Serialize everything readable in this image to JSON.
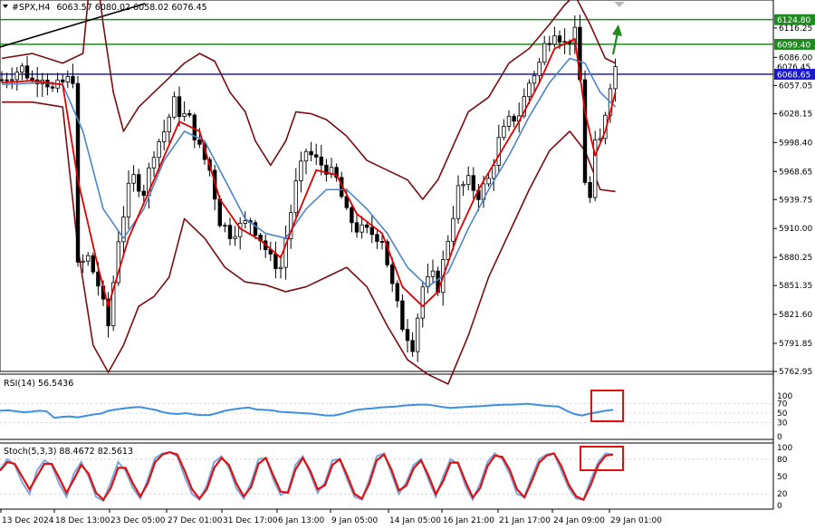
{
  "header": {
    "symbol": "#SPX,H4",
    "ohlc": "6063.57 6080.02 6058.02 6076.45"
  },
  "rsi_label": "RSI(14) 56.5436",
  "stoch_label": "Stoch(5,3,3) 88.4672 82.5613",
  "colors": {
    "candle": "#000000",
    "bb": "#7a0d10",
    "ma_fast": "#e00000",
    "ma_slow": "#4a86c8",
    "rsi": "#3d8fe0",
    "stoch_main": "#7ba7de",
    "stoch_signal": "#e01010",
    "resistance": "#1f8a1f",
    "current": "#1a1acc",
    "trend": "#000000",
    "highlight": "#e01010",
    "arrow": "#1f8a1f"
  },
  "chart_data": [
    {
      "type": "candlestick",
      "price_ticks": [
        6116.25,
        6086.0,
        6057.05,
        6028.15,
        5998.4,
        5968.65,
        5939.75,
        5910.0,
        5880.25,
        5851.35,
        5821.6,
        5791.85,
        5762.95
      ],
      "ylim": [
        5762.95,
        6145.0
      ],
      "price_tags": [
        {
          "value": 6124.8,
          "label": "6124.80",
          "kind": "resistance"
        },
        {
          "value": 6099.4,
          "label": "6099.40",
          "kind": "resistance"
        },
        {
          "value": 6076.45,
          "label": "6076.45",
          "kind": "last"
        },
        {
          "value": 6068.65,
          "label": "6068.65",
          "kind": "current"
        }
      ],
      "time_labels": [
        "13 Dec 2024",
        "18 Dec 13:00",
        "23 Dec 05:00",
        "27 Dec 01:00",
        "31 Dec 17:00",
        "6 Jan 13:00",
        "9 Jan 05:00",
        "14 Jan 05:00",
        "16 Jan 21:00",
        "21 Jan 17:00",
        "24 Jan 09:00",
        "29 Jan 01:00"
      ],
      "close_path": [
        [
          0,
          6063
        ],
        [
          4,
          6075
        ],
        [
          6,
          6062
        ],
        [
          8,
          6068
        ],
        [
          10,
          6052
        ],
        [
          12,
          6060
        ],
        [
          14,
          6065
        ],
        [
          15,
          5870
        ],
        [
          17,
          5880
        ],
        [
          19,
          5852
        ],
        [
          21,
          5810
        ],
        [
          23,
          5900
        ],
        [
          25,
          5950
        ],
        [
          26,
          5962
        ],
        [
          28,
          5948
        ],
        [
          30,
          5990
        ],
        [
          32,
          6010
        ],
        [
          34,
          6040
        ],
        [
          35,
          6030
        ],
        [
          37,
          6022
        ],
        [
          39,
          5992
        ],
        [
          41,
          5970
        ],
        [
          43,
          5918
        ],
        [
          45,
          5905
        ],
        [
          47,
          5912
        ],
        [
          49,
          5918
        ],
        [
          51,
          5900
        ],
        [
          53,
          5878
        ],
        [
          55,
          5870
        ],
        [
          56,
          5900
        ],
        [
          58,
          5955
        ],
        [
          60,
          5990
        ],
        [
          62,
          5980
        ],
        [
          64,
          5972
        ],
        [
          66,
          5960
        ],
        [
          68,
          5925
        ],
        [
          70,
          5910
        ],
        [
          71,
          5908
        ],
        [
          73,
          5905
        ],
        [
          75,
          5900
        ],
        [
          77,
          5850
        ],
        [
          79,
          5810
        ],
        [
          81,
          5790
        ],
        [
          83,
          5850
        ],
        [
          85,
          5860
        ],
        [
          86,
          5850
        ],
        [
          88,
          5900
        ],
        [
          90,
          5950
        ],
        [
          92,
          5958
        ],
        [
          94,
          5945
        ],
        [
          96,
          5960
        ],
        [
          98,
          6000
        ],
        [
          100,
          6020
        ],
        [
          102,
          6028
        ],
        [
          104,
          6060
        ],
        [
          106,
          6080
        ],
        [
          107,
          6098
        ],
        [
          109,
          6115
        ],
        [
          111,
          6100
        ],
        [
          113,
          6110
        ],
        [
          114,
          6062
        ],
        [
          115,
          5960
        ],
        [
          116,
          5940
        ],
        [
          117,
          5995
        ],
        [
          118,
          6000
        ],
        [
          119,
          6030
        ],
        [
          120,
          6060
        ],
        [
          121,
          6076
        ]
      ],
      "ma_fast_path": [
        [
          0,
          6060
        ],
        [
          6,
          6062
        ],
        [
          12,
          6058
        ],
        [
          15,
          5960
        ],
        [
          19,
          5870
        ],
        [
          21,
          5830
        ],
        [
          25,
          5900
        ],
        [
          30,
          5960
        ],
        [
          35,
          6020
        ],
        [
          39,
          6010
        ],
        [
          43,
          5940
        ],
        [
          47,
          5910
        ],
        [
          51,
          5898
        ],
        [
          55,
          5880
        ],
        [
          58,
          5920
        ],
        [
          62,
          5970
        ],
        [
          66,
          5965
        ],
        [
          70,
          5925
        ],
        [
          75,
          5905
        ],
        [
          79,
          5850
        ],
        [
          83,
          5830
        ],
        [
          86,
          5845
        ],
        [
          90,
          5905
        ],
        [
          94,
          5950
        ],
        [
          98,
          5985
        ],
        [
          102,
          6020
        ],
        [
          106,
          6060
        ],
        [
          109,
          6095
        ],
        [
          113,
          6105
        ],
        [
          115,
          6030
        ],
        [
          117,
          5985
        ],
        [
          119,
          6010
        ],
        [
          121,
          6050
        ]
      ],
      "ma_slow_path": [
        [
          0,
          6058
        ],
        [
          8,
          6060
        ],
        [
          12,
          6058
        ],
        [
          16,
          6010
        ],
        [
          20,
          5930
        ],
        [
          24,
          5900
        ],
        [
          28,
          5930
        ],
        [
          32,
          5980
        ],
        [
          36,
          6010
        ],
        [
          40,
          6000
        ],
        [
          44,
          5960
        ],
        [
          48,
          5920
        ],
        [
          52,
          5905
        ],
        [
          56,
          5900
        ],
        [
          60,
          5930
        ],
        [
          64,
          5950
        ],
        [
          68,
          5950
        ],
        [
          72,
          5930
        ],
        [
          76,
          5905
        ],
        [
          80,
          5870
        ],
        [
          84,
          5850
        ],
        [
          88,
          5865
        ],
        [
          92,
          5910
        ],
        [
          96,
          5950
        ],
        [
          100,
          5985
        ],
        [
          104,
          6025
        ],
        [
          108,
          6060
        ],
        [
          112,
          6085
        ],
        [
          115,
          6080
        ],
        [
          118,
          6050
        ],
        [
          121,
          6035
        ]
      ],
      "bb_upper_path": [
        [
          0,
          6085
        ],
        [
          6,
          6090
        ],
        [
          12,
          6080
        ],
        [
          16,
          6090
        ],
        [
          18,
          6200
        ],
        [
          20,
          6120
        ],
        [
          22,
          6050
        ],
        [
          24,
          6010
        ],
        [
          27,
          6035
        ],
        [
          30,
          6050
        ],
        [
          33,
          6065
        ],
        [
          36,
          6080
        ],
        [
          39,
          6090
        ],
        [
          42,
          6082
        ],
        [
          45,
          6050
        ],
        [
          48,
          6030
        ],
        [
          50,
          6000
        ],
        [
          53,
          5975
        ],
        [
          56,
          6000
        ],
        [
          58,
          6030
        ],
        [
          61,
          6028
        ],
        [
          64,
          6022
        ],
        [
          68,
          6005
        ],
        [
          72,
          5980
        ],
        [
          76,
          5970
        ],
        [
          80,
          5960
        ],
        [
          83,
          5940
        ],
        [
          86,
          5960
        ],
        [
          89,
          5995
        ],
        [
          92,
          6030
        ],
        [
          96,
          6045
        ],
        [
          100,
          6080
        ],
        [
          104,
          6095
        ],
        [
          108,
          6120
        ],
        [
          111,
          6140
        ],
        [
          113,
          6150
        ],
        [
          116,
          6120
        ],
        [
          119,
          6085
        ],
        [
          121,
          6080
        ]
      ],
      "bb_lower_path": [
        [
          0,
          6040
        ],
        [
          6,
          6040
        ],
        [
          12,
          6035
        ],
        [
          15,
          5890
        ],
        [
          18,
          5790
        ],
        [
          21,
          5762
        ],
        [
          24,
          5790
        ],
        [
          27,
          5830
        ],
        [
          30,
          5840
        ],
        [
          33,
          5860
        ],
        [
          36,
          5920
        ],
        [
          40,
          5900
        ],
        [
          44,
          5870
        ],
        [
          48,
          5855
        ],
        [
          52,
          5852
        ],
        [
          56,
          5845
        ],
        [
          60,
          5850
        ],
        [
          64,
          5860
        ],
        [
          68,
          5870
        ],
        [
          72,
          5850
        ],
        [
          76,
          5810
        ],
        [
          80,
          5775
        ],
        [
          84,
          5760
        ],
        [
          88,
          5750
        ],
        [
          92,
          5800
        ],
        [
          96,
          5860
        ],
        [
          100,
          5905
        ],
        [
          104,
          5950
        ],
        [
          108,
          5990
        ],
        [
          112,
          6010
        ],
        [
          115,
          5990
        ],
        [
          118,
          5950
        ],
        [
          121,
          5948
        ]
      ]
    },
    {
      "type": "line",
      "title": "RSI(14) 56.5436",
      "ylim": [
        0,
        100
      ],
      "ticks": [
        100,
        70,
        50,
        30,
        0
      ],
      "values": [
        55,
        56,
        54,
        52,
        53,
        55,
        54,
        40,
        42,
        43,
        41,
        44,
        47,
        49,
        55,
        58,
        60,
        62,
        63,
        60,
        57,
        52,
        49,
        48,
        50,
        47,
        46,
        46,
        50,
        55,
        58,
        60,
        62,
        58,
        57,
        56,
        53,
        52,
        51,
        50,
        49,
        47,
        45,
        45,
        48,
        53,
        57,
        59,
        60,
        62,
        63,
        64,
        66,
        67,
        68,
        68,
        66,
        63,
        61,
        62,
        63,
        64,
        65,
        66,
        67,
        68,
        68,
        69,
        70,
        68,
        66,
        65,
        64,
        55,
        48,
        45,
        49,
        52,
        55,
        57
      ]
    },
    {
      "type": "line",
      "title": "Stoch(5,3,3) 88.4672 82.5613",
      "ylim": [
        0,
        100
      ],
      "ticks": [
        100,
        80,
        50,
        20,
        0
      ],
      "series": [
        {
          "values": [
            62,
            80,
            70,
            40,
            20,
            60,
            78,
            70,
            38,
            15,
            55,
            75,
            50,
            15,
            8,
            40,
            75,
            60,
            30,
            12,
            45,
            82,
            90,
            92,
            85,
            50,
            20,
            10,
            35,
            75,
            85,
            65,
            30,
            12,
            40,
            80,
            82,
            45,
            18,
            25,
            70,
            85,
            55,
            22,
            40,
            78,
            80,
            45,
            15,
            10,
            45,
            85,
            90,
            55,
            20,
            40,
            70,
            80,
            45,
            15,
            50,
            80,
            72,
            35,
            10,
            38,
            75,
            90,
            80,
            55,
            20,
            15,
            50,
            80,
            88,
            90,
            60,
            30,
            12,
            10,
            45,
            75,
            90,
            88
          ]
        },
        {
          "values": [
            60,
            75,
            72,
            50,
            28,
            50,
            72,
            72,
            48,
            22,
            45,
            70,
            55,
            22,
            10,
            30,
            65,
            65,
            38,
            16,
            38,
            75,
            88,
            92,
            88,
            60,
            28,
            12,
            28,
            65,
            82,
            70,
            38,
            16,
            32,
            72,
            82,
            52,
            24,
            22,
            62,
            82,
            60,
            28,
            35,
            70,
            80,
            52,
            20,
            12,
            38,
            78,
            88,
            62,
            26,
            34,
            64,
            78,
            52,
            20,
            42,
            74,
            74,
            42,
            14,
            30,
            68,
            86,
            84,
            62,
            28,
            14,
            42,
            74,
            86,
            90,
            68,
            36,
            16,
            10,
            36,
            70,
            86,
            88
          ]
        }
      ]
    }
  ]
}
